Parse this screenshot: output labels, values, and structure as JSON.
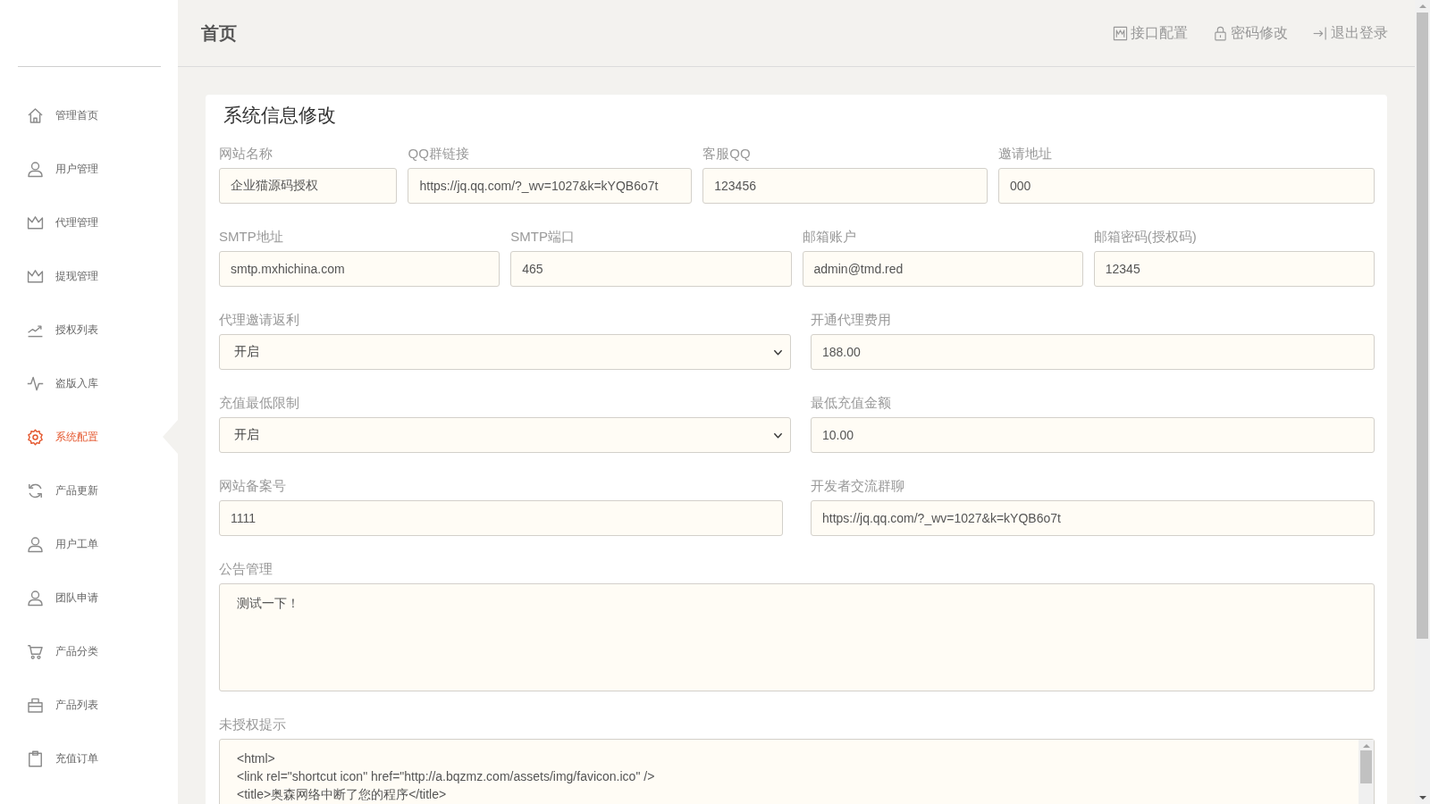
{
  "sidebar": {
    "items": [
      {
        "label": "管理首页",
        "selected": false
      },
      {
        "label": "用户管理",
        "selected": false
      },
      {
        "label": "代理管理",
        "selected": false
      },
      {
        "label": "提现管理",
        "selected": false
      },
      {
        "label": "授权列表",
        "selected": false
      },
      {
        "label": "盗版入库",
        "selected": false
      },
      {
        "label": "系统配置",
        "selected": true
      },
      {
        "label": "产品更新",
        "selected": false
      },
      {
        "label": "用户工单",
        "selected": false
      },
      {
        "label": "团队申请",
        "selected": false
      },
      {
        "label": "产品分类",
        "selected": false
      },
      {
        "label": "产品列表",
        "selected": false
      },
      {
        "label": "充值订单",
        "selected": false
      }
    ]
  },
  "header": {
    "title": "首页",
    "links": [
      {
        "label": "接口配置"
      },
      {
        "label": "密码修改"
      },
      {
        "label": "退出登录"
      }
    ]
  },
  "form": {
    "title": "系统信息修改",
    "rows": [
      {
        "fields": [
          {
            "kind": "input",
            "label": "网站名称",
            "value": "企业猫源码授权"
          },
          {
            "kind": "input",
            "label": "QQ群链接",
            "value": "https://jq.qq.com/?_wv=1027&k=kYQB6o7t"
          },
          {
            "kind": "input",
            "label": "客服QQ",
            "value": "123456"
          },
          {
            "kind": "input",
            "label": "邀请地址",
            "value": "000"
          }
        ]
      },
      {
        "fields": [
          {
            "kind": "input",
            "label": "SMTP地址",
            "value": "smtp.mxhichina.com"
          },
          {
            "kind": "input",
            "label": "SMTP端口",
            "value": "465"
          },
          {
            "kind": "input",
            "label": "邮箱账户",
            "value": "admin@tmd.red"
          },
          {
            "kind": "input",
            "label": "邮箱密码(授权码)",
            "value": "12345"
          }
        ]
      },
      {
        "fields": [
          {
            "kind": "select",
            "label": "代理邀请返利",
            "value": "开启"
          },
          {
            "kind": "input",
            "label": "开通代理费用",
            "value": "188.00"
          }
        ]
      },
      {
        "fields": [
          {
            "kind": "select",
            "label": "充值最低限制",
            "value": "开启"
          },
          {
            "kind": "input",
            "label": "最低充值金额",
            "value": "10.00"
          }
        ]
      },
      {
        "fields": [
          {
            "kind": "input",
            "label": "网站备案号",
            "value": "1111"
          },
          {
            "kind": "input",
            "label": "开发者交流群聊",
            "value": "https://jq.qq.com/?_wv=1027&k=kYQB6o7t"
          }
        ]
      },
      {
        "fields": [
          {
            "kind": "textarea",
            "label": "公告管理",
            "value": "测试一下！"
          }
        ]
      },
      {
        "fields": [
          {
            "kind": "textarea",
            "label": "未授权提示",
            "value": "<html>\n<link rel=\"shortcut icon\" href=\"http://a.bqzmz.com/assets/img/favicon.ico\" />\n<title>奥森网络中断了您的程序</title>"
          }
        ]
      }
    ]
  }
}
